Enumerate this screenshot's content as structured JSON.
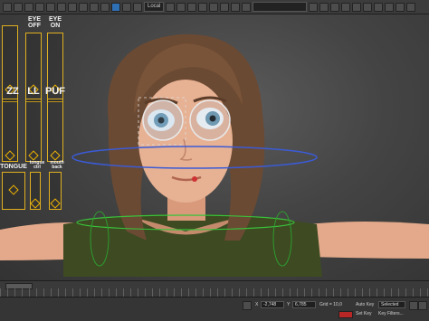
{
  "toolbar": {
    "dropdown_label": "Local"
  },
  "rig": {
    "labels": {
      "eye_off": "EYE OFF",
      "eye_on": "EYE ON",
      "zz": "ZZ",
      "ll": "LL",
      "puf": "PUF",
      "tongue": "TONGUE",
      "tongue_sub": "tongue",
      "tongue_sub2": "ctrl",
      "mouth_back": "mouth back"
    }
  },
  "status": {
    "x_value": "-2,748",
    "y_value": "6,785",
    "grid_value": "Grid = 10,0",
    "auto_key": "Auto Key",
    "selected": "Selected",
    "set_key": "Set Key",
    "key_filters": "Key Filters..."
  },
  "colors": {
    "rig_accent": "#e0b020",
    "autokey_red": "#b82626",
    "sweater": "#3d4a22"
  }
}
